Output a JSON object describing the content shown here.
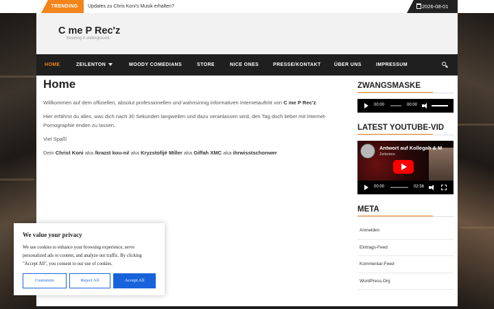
{
  "topbar": {
    "trending_label": "TRENDING",
    "ticker_text": "Updates zu Chris Koni's Musik erhalten?",
    "date": "2026-08-01",
    "calendar_icon": "calendar-icon"
  },
  "site": {
    "title": "C me P Rec'z",
    "tagline": "Keeping it underground."
  },
  "nav": {
    "items": [
      {
        "label": "HOME",
        "active": true
      },
      {
        "label": "ZEILENTON",
        "dropdown": true
      },
      {
        "label": "MOODY COMEDIANS"
      },
      {
        "label": "STORE"
      },
      {
        "label": "NICE ONES"
      },
      {
        "label": "PRESSE/KONTAKT"
      },
      {
        "label": "ÜBER UNS"
      },
      {
        "label": "IMPRESSUM"
      }
    ],
    "search_icon": "search-icon"
  },
  "main": {
    "heading": "Home",
    "p1_a": "Willkommen auf dem offiziellen, absolut professionellen und wahnsinnig informativen Internetauftritt von ",
    "p1_b": "C me P Rec'z",
    "p1_c": ".",
    "p2": "Hier erfährst du alles, was dich nach 30 Sekunden langweilen und dazu veranlassen wird, den Tag doch lieber mit Internet-Pornographie enden zu lassen.",
    "p3": "Viel Spaß!",
    "p4": {
      "t1": "Dein ",
      "b1": "Christ Koni",
      "t2": " aka ",
      "b2": "/kraɪst koʊ-ni/",
      "t3": " aka ",
      "b3": "Kryzstofijé Miller",
      "t4": " aka ",
      "b4": "Giffah XMC",
      "t5": " aka ",
      "b5": "ihrwisstschonwer"
    }
  },
  "sidebar": {
    "zwangsmaske": {
      "title": "ZWANGSMASKE",
      "current_time": "00:00",
      "duration": "00:00"
    },
    "youtube": {
      "title": "LATEST YOUTUBE-VID",
      "video_title": "Antwort auf Kollegah & M",
      "channel": "Zeilenton",
      "current_time": "00:00",
      "duration": "02:56"
    },
    "meta": {
      "title": "META",
      "links": [
        "Anmelden",
        "Eintrags-Feed",
        "Kommentar-Feed",
        "WordPress.Org"
      ]
    }
  },
  "cookie": {
    "title": "We value your privacy",
    "body": "We use cookies to enhance your browsing experience, serve personalized ads or content, and analyze our traffic. By clicking \"Accept All\", you consent to our use of cookies.",
    "customize": "Customize",
    "reject": "Reject All",
    "accept": "Accept All"
  },
  "colors": {
    "accent": "#f3851c",
    "nav_bg": "#1f1f1f",
    "cookie_button": "#1863dc",
    "youtube_red": "#ff0000"
  }
}
